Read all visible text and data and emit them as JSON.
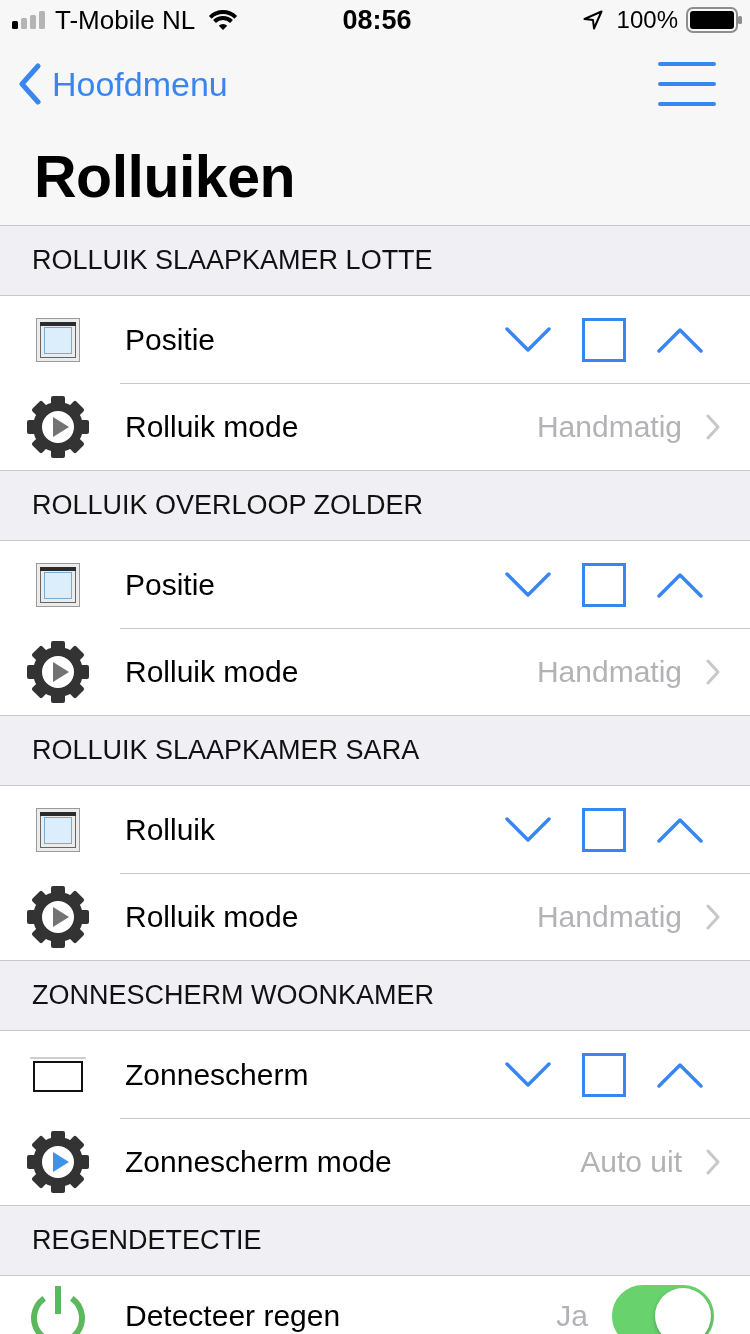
{
  "status_bar": {
    "carrier": "T-Mobile NL",
    "time": "08:56",
    "battery": "100%"
  },
  "nav_bar": {
    "back": "Hoofdmenu"
  },
  "title": "Rolluiken",
  "sections": [
    {
      "title": "ROLLUIK SLAAPKAMER LOTTE",
      "rows": [
        {
          "kind": "shutter",
          "label": "Positie"
        },
        {
          "kind": "mode",
          "label": "Rolluik mode",
          "value": "Handmatig",
          "color": "#737373"
        }
      ]
    },
    {
      "title": "ROLLUIK OVERLOOP ZOLDER",
      "rows": [
        {
          "kind": "shutter",
          "label": "Positie"
        },
        {
          "kind": "mode",
          "label": "Rolluik mode",
          "value": "Handmatig",
          "color": "#737373"
        }
      ]
    },
    {
      "title": "ROLLUIK SLAAPKAMER SARA",
      "rows": [
        {
          "kind": "shutter",
          "label": "Rolluik"
        },
        {
          "kind": "mode",
          "label": "Rolluik mode",
          "value": "Handmatig",
          "color": "#737373"
        }
      ]
    },
    {
      "title": "ZONNESCHERM WOONKAMER",
      "rows": [
        {
          "kind": "awning",
          "label": "Zonnescherm"
        },
        {
          "kind": "mode",
          "label": "Zonnescherm mode",
          "value": "Auto uit",
          "color": "#3d93e8"
        }
      ]
    },
    {
      "title": "REGENDETECTIE",
      "rows": [
        {
          "kind": "toggle",
          "label": "Detecteer regen",
          "value": "Ja",
          "on": true
        }
      ]
    }
  ]
}
